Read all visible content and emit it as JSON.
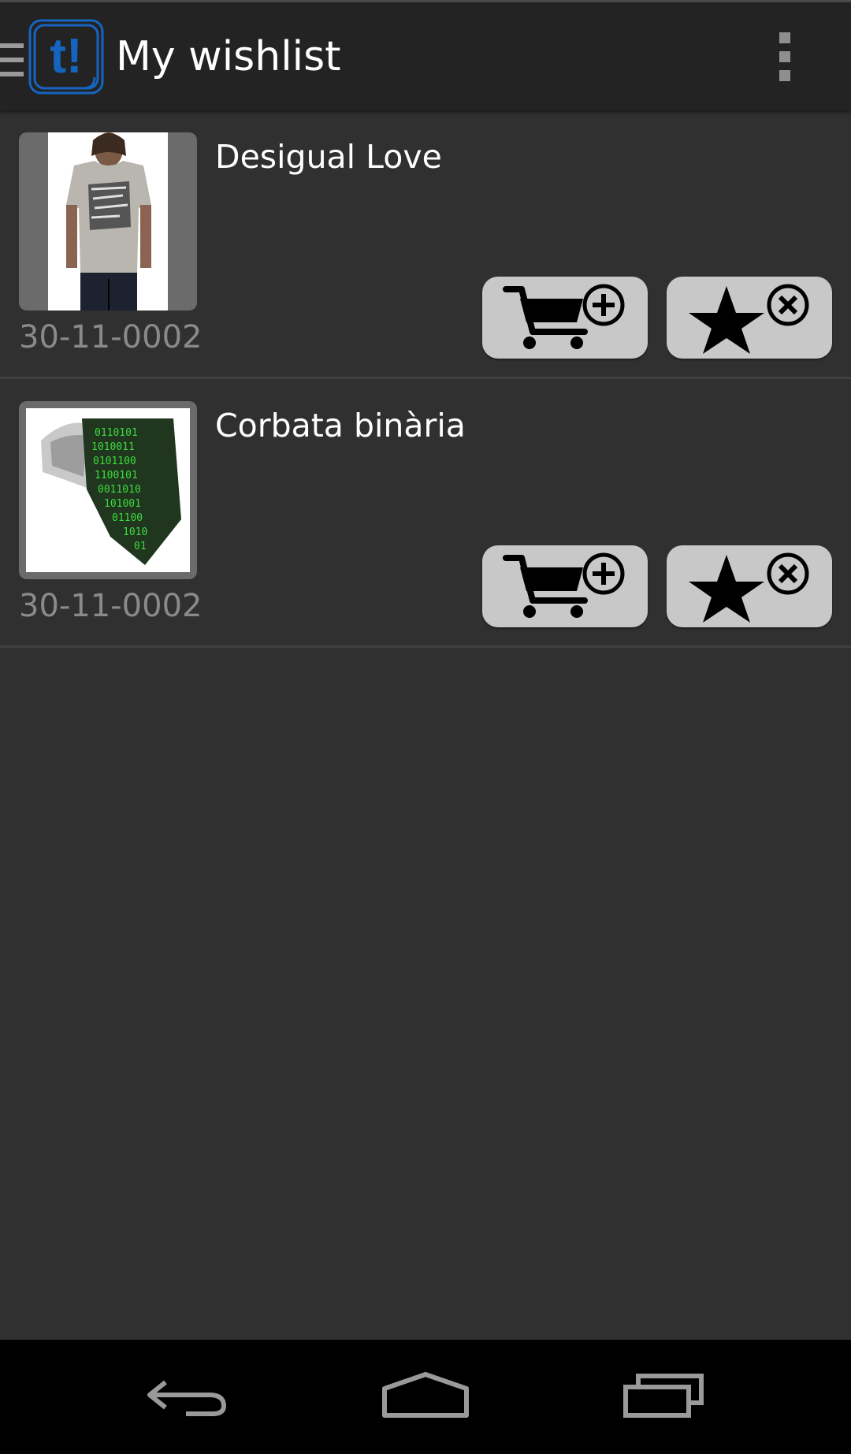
{
  "action_bar": {
    "title": "My wishlist",
    "icons": {
      "drawer": "menu-drawer-icon",
      "logo": "app-logo-icon",
      "overflow": "overflow-menu-icon"
    },
    "logo_text": "t!"
  },
  "wishlist": {
    "items": [
      {
        "title": "Desigual Love",
        "date": "30-11-0002",
        "image": "tshirt-product-image",
        "add_to_cart_icon": "cart-add-icon",
        "remove_icon": "star-remove-icon"
      },
      {
        "title": "Corbata binària",
        "date": "30-11-0002",
        "image": "tie-product-image",
        "add_to_cart_icon": "cart-add-icon",
        "remove_icon": "star-remove-icon"
      }
    ]
  },
  "navigation_bar": {
    "icons": [
      "back-icon",
      "home-icon",
      "recent-apps-icon"
    ]
  },
  "colors": {
    "background": "#303030",
    "action_bar": "#232323",
    "accent": "#1565c0",
    "button": "#c8c8c8",
    "date_text": "#8a8a8a"
  }
}
